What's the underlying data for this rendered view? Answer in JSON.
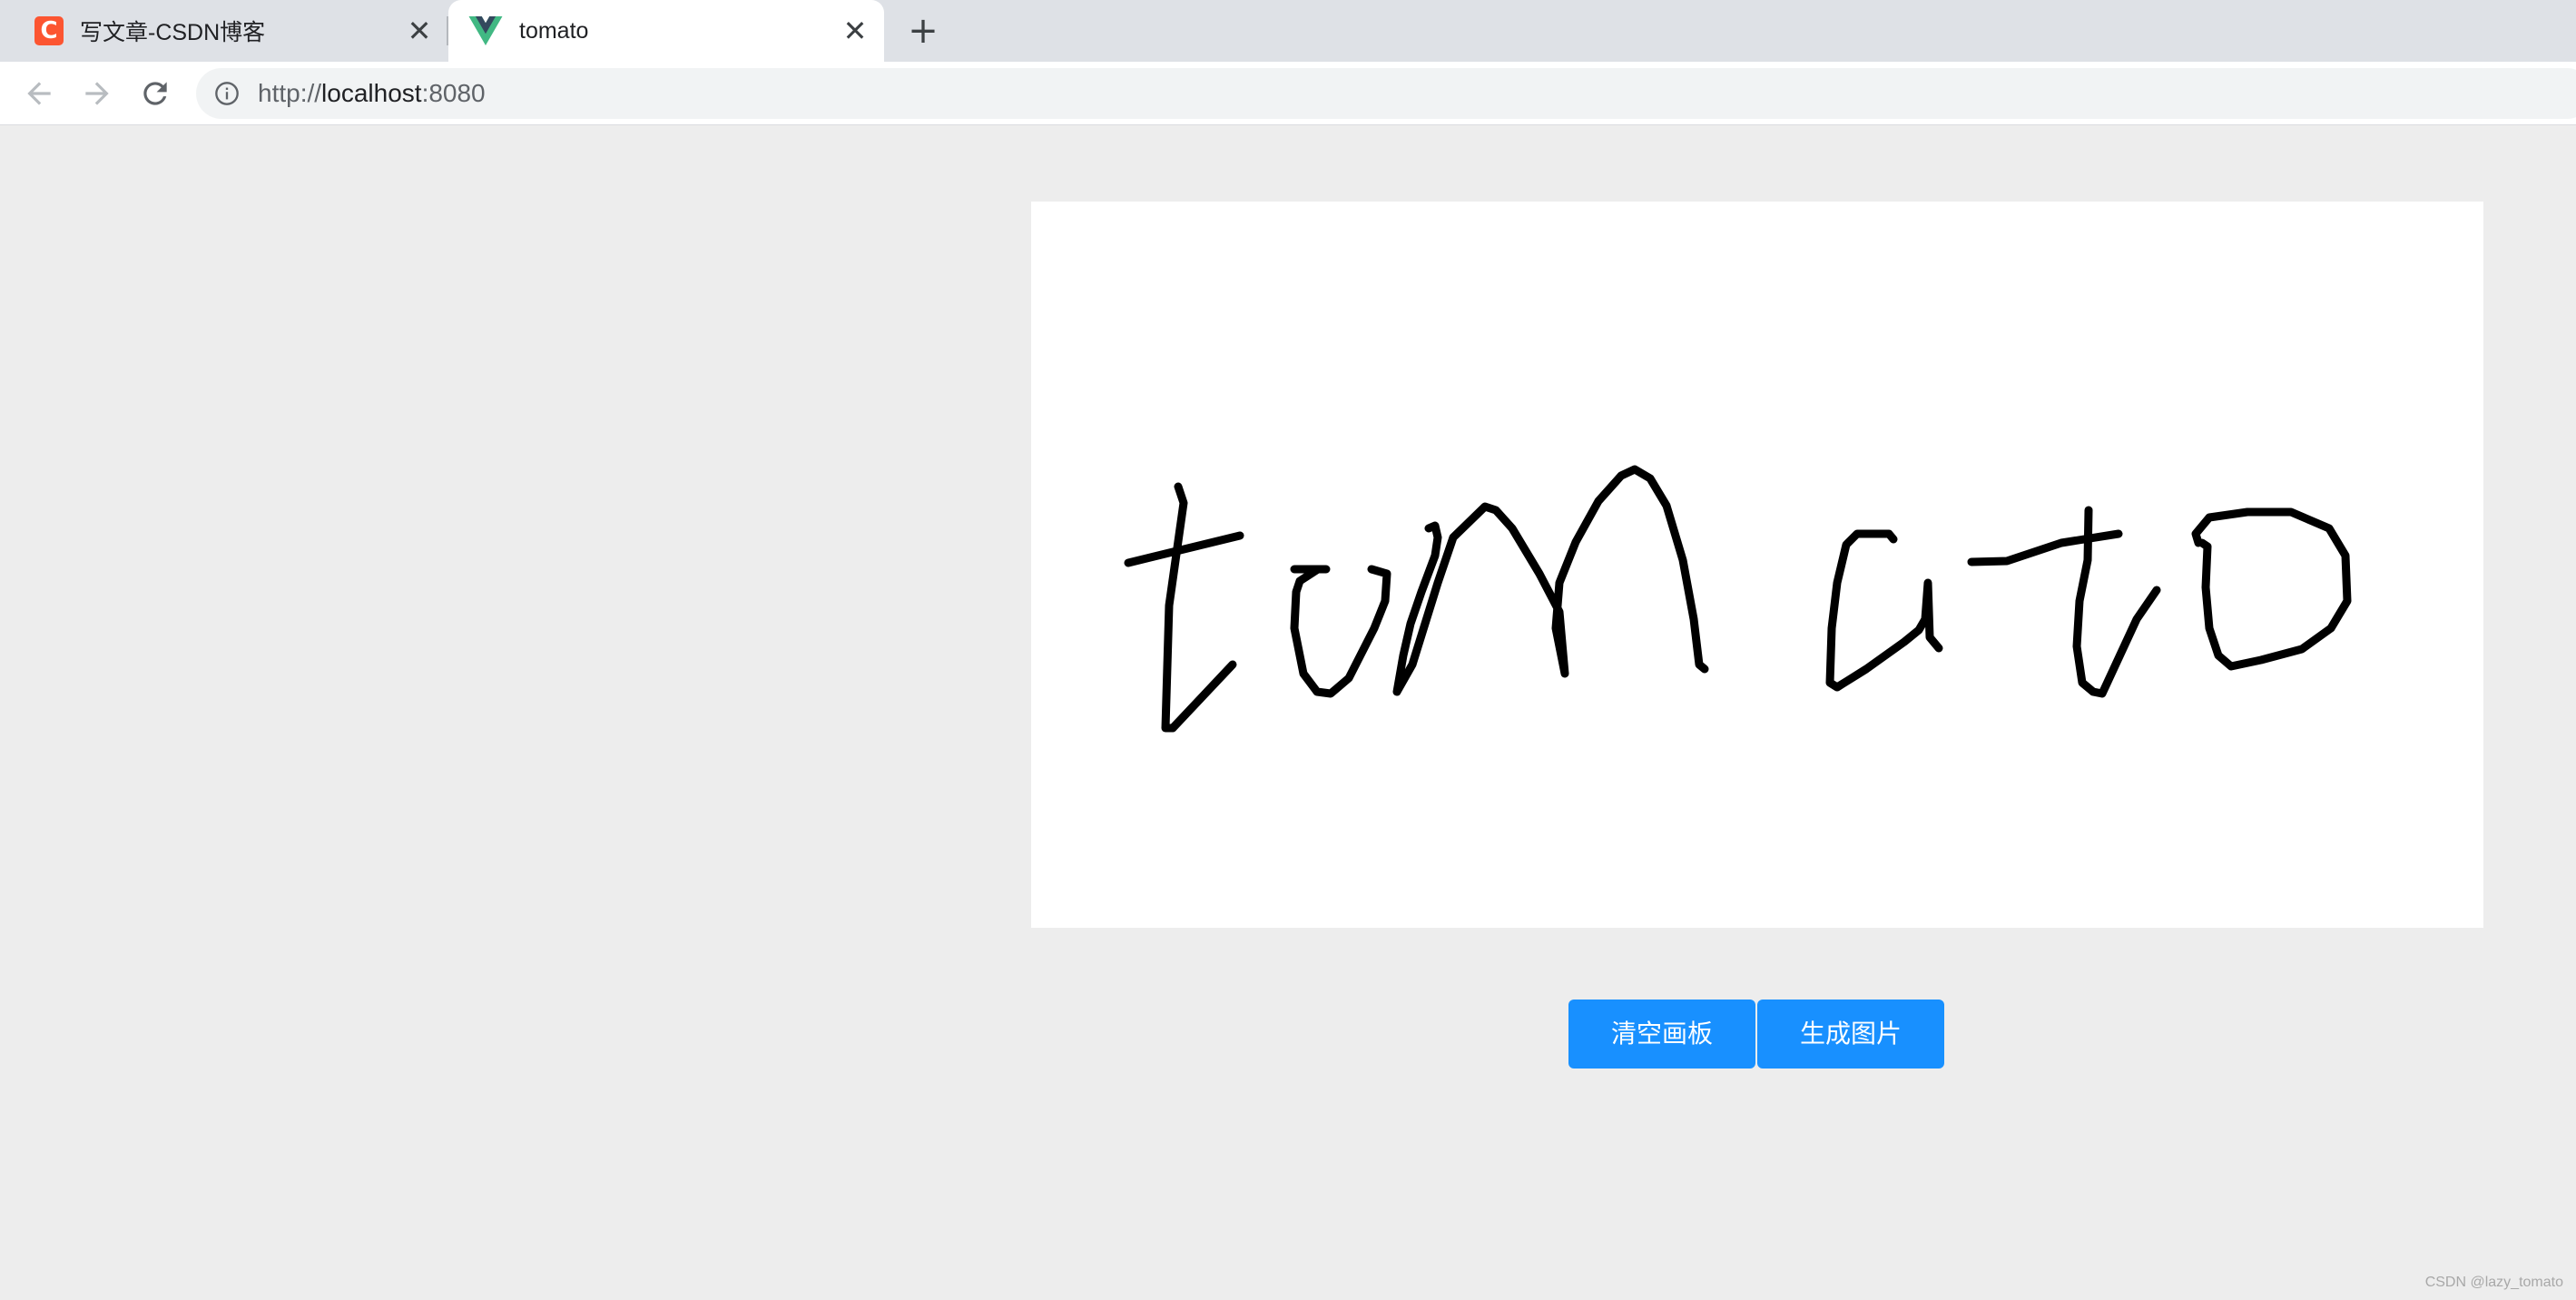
{
  "tabs": [
    {
      "title": "写文章-CSDN博客",
      "favicon_letter": "C",
      "active": false
    },
    {
      "title": "tomato",
      "active": true
    }
  ],
  "tab_close_glyph": "✕",
  "new_tab_glyph": "+",
  "toolbar": {
    "back_icon": "arrow-left-icon",
    "forward_icon": "arrow-right-icon",
    "reload_icon": "reload-icon",
    "address": {
      "scheme": "http://",
      "host": "localhost",
      "port": ":8080"
    }
  },
  "canvas": {
    "handwriting": "tomato",
    "stroke_color": "#000000",
    "background": "#ffffff"
  },
  "buttons": {
    "clear": "清空画板",
    "generate": "生成图片"
  },
  "colors": {
    "primary_button": "#1890ff",
    "csdn_brand": "#fc5531",
    "page_background": "#ededed"
  },
  "watermark": "CSDN @lazy_tomato"
}
